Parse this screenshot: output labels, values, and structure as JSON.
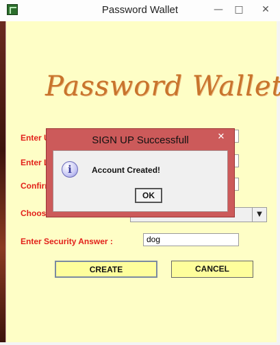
{
  "window": {
    "title": "Password Wallet",
    "app_icon": "app-icon",
    "minimize": "—",
    "maximize": "□",
    "close": "✕"
  },
  "logo": {
    "text": "Password Wallet"
  },
  "form": {
    "labels": {
      "user": "Enter U",
      "login": "Enter L",
      "confirm": "Confirm",
      "choose": "Choos",
      "security_answer": "Enter Security Answer :"
    },
    "security_answer_value": "dog",
    "create_label": "CREATE",
    "cancel_label": "CANCEL"
  },
  "dialog": {
    "title": "SIGN UP Successfull",
    "message": "Account Created!",
    "ok_label": "OK",
    "icon": "info-icon",
    "close": "✕"
  },
  "colors": {
    "background": "#fefec6",
    "label": "#e2201a",
    "button": "#fefe9c",
    "dialog_frame": "#cc5a5a"
  }
}
